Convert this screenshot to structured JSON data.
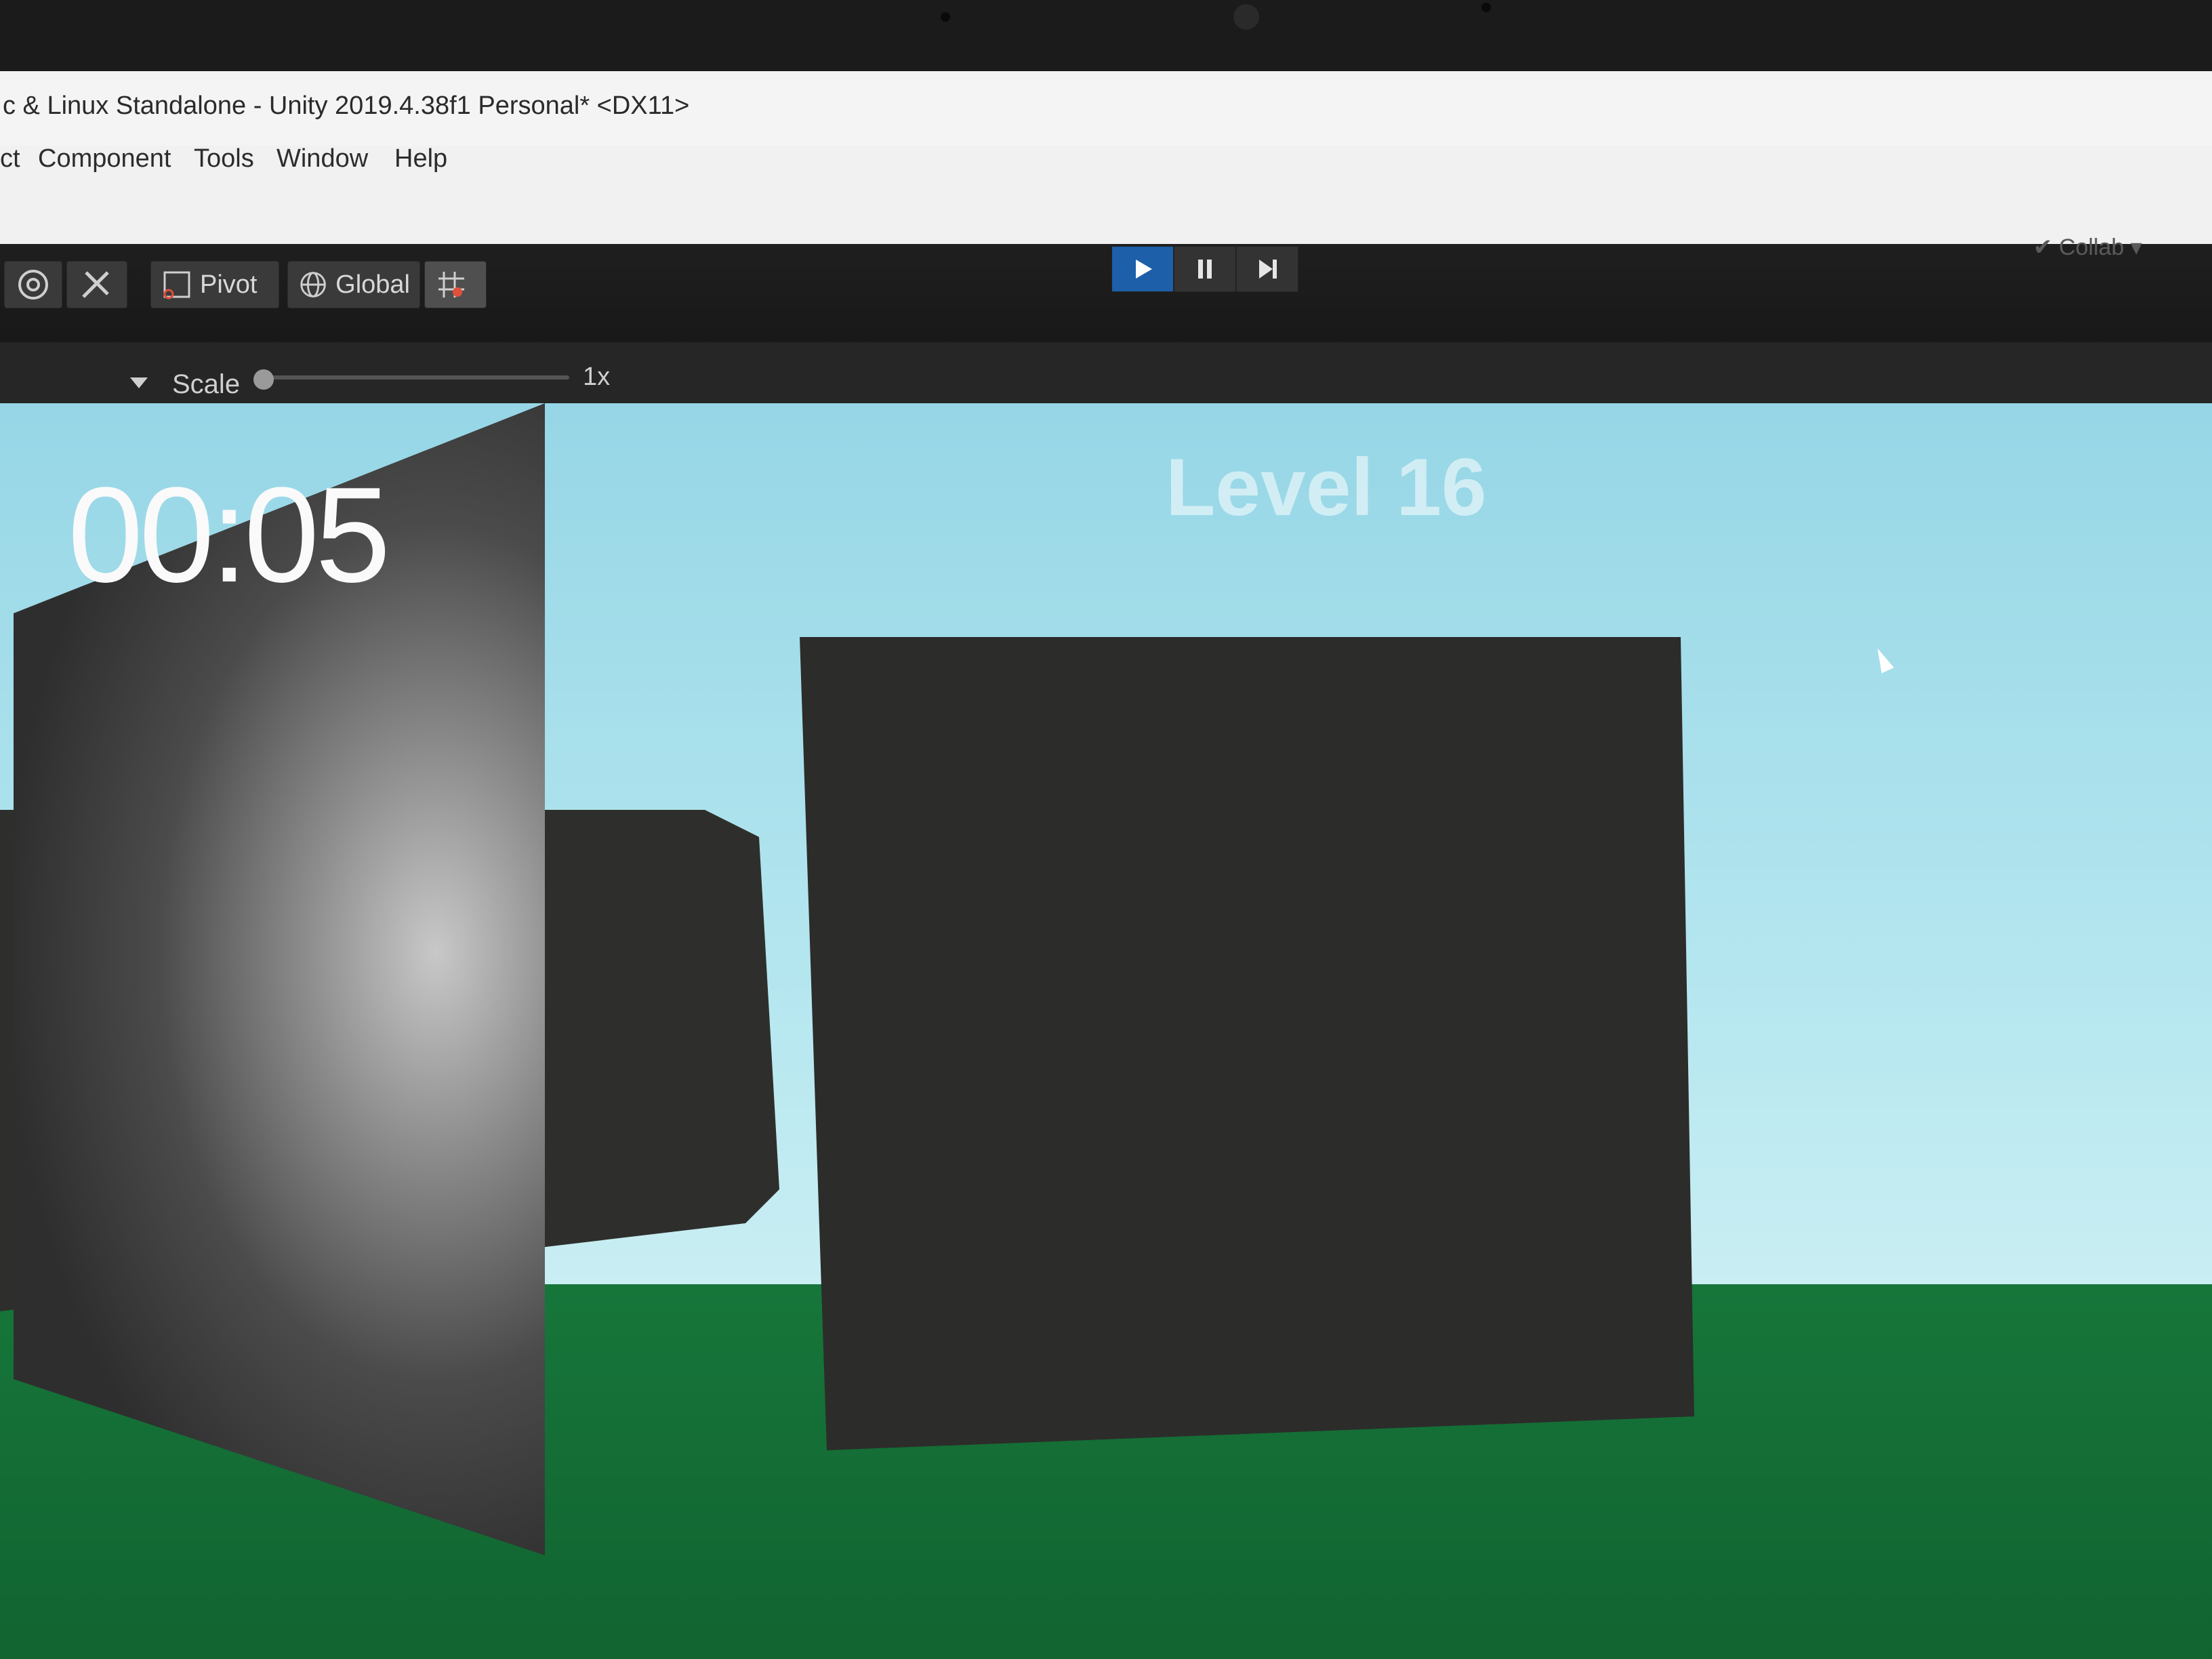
{
  "window": {
    "title": "c & Linux Standalone - Unity 2019.4.38f1 Personal* <DX11>"
  },
  "menu": {
    "items": [
      "ct",
      "Component",
      "Tools",
      "Window",
      "Help"
    ]
  },
  "toolbar": {
    "pivot_label": "Pivot",
    "global_label": "Global",
    "collab_label": "Collab"
  },
  "play_controls": {
    "play": "play-icon",
    "pause": "pause-icon",
    "step": "step-icon",
    "play_active_color": "#1d5fa8"
  },
  "game_view": {
    "scale_label": "Scale",
    "scale_value": "1x",
    "scale_level": 0.0
  },
  "game_hud": {
    "timer": "00:05",
    "level": "Level 16"
  },
  "colors": {
    "sky": "#b4e6ef",
    "ground": "#16763a",
    "wall": "#2e2f2c"
  }
}
